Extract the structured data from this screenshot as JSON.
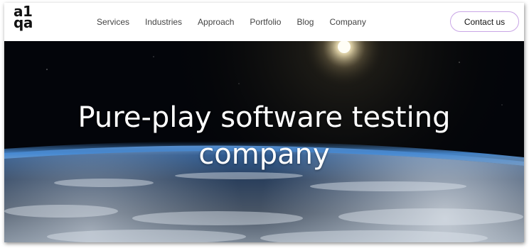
{
  "logo": {
    "line1": "a1",
    "line2": "qa"
  },
  "nav": {
    "items": [
      {
        "label": "Services"
      },
      {
        "label": "Industries"
      },
      {
        "label": "Approach"
      },
      {
        "label": "Portfolio"
      },
      {
        "label": "Blog"
      },
      {
        "label": "Company"
      }
    ]
  },
  "header": {
    "contact_label": "Contact us"
  },
  "hero": {
    "title_line1": "Pure-play software testing",
    "title_line2": "company"
  },
  "colors": {
    "button_border": "#c9a6e6",
    "hero_background": "#030509",
    "atmosphere": "#4a8ed8"
  },
  "icons": {
    "background": "earth-from-space-image"
  }
}
